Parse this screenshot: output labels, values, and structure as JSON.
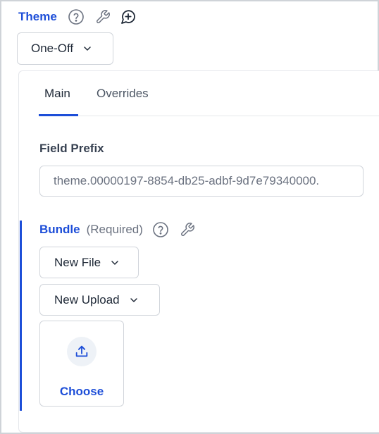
{
  "theme": {
    "title": "Theme",
    "mode_select": {
      "selected": "One-Off"
    }
  },
  "tabs": [
    {
      "label": "Main",
      "active": true
    },
    {
      "label": "Overrides",
      "active": false
    }
  ],
  "field_prefix": {
    "label": "Field Prefix",
    "value": "theme.00000197-8854-db25-adbf-9d7e79340000."
  },
  "bundle": {
    "title": "Bundle",
    "required_text": "(Required)",
    "source_select": {
      "selected": "New File"
    },
    "upload_select": {
      "selected": "New Upload"
    },
    "choose_label": "Choose"
  },
  "colors": {
    "accent": "#1d4ed8",
    "border": "#d1d5db",
    "muted_text": "#6b7280"
  },
  "icons": {
    "help": "help-circle-icon",
    "wrench": "wrench-icon",
    "comment_add": "comment-add-icon",
    "chevron": "chevron-down-icon",
    "upload": "upload-icon"
  }
}
